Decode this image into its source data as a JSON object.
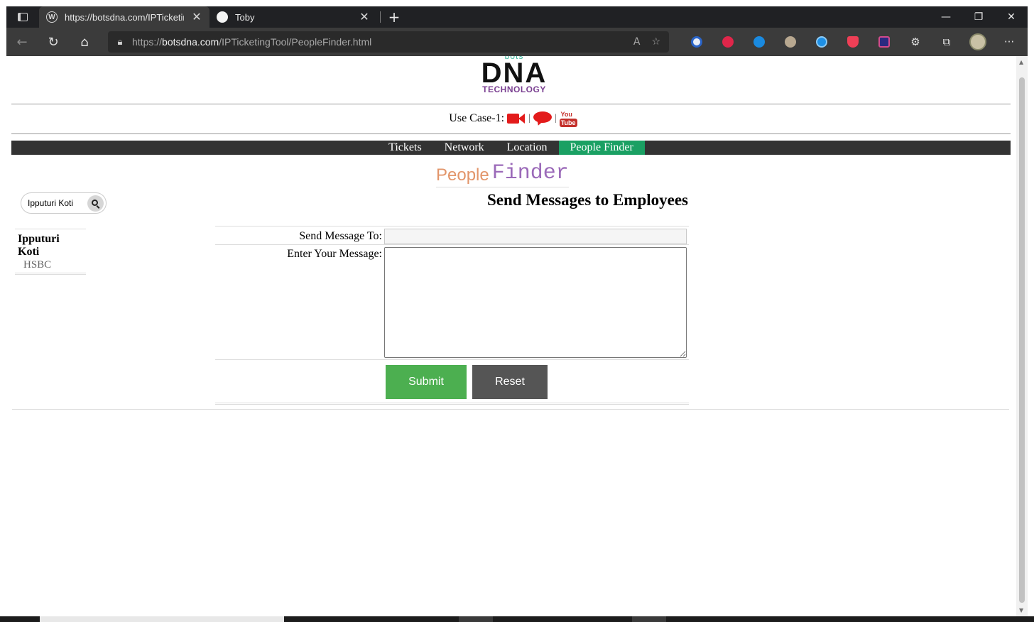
{
  "browser": {
    "tabs": [
      {
        "title": "https://botsdna.com/IPTicketing",
        "active": true,
        "favicon": "wordpress-icon"
      },
      {
        "title": "Toby",
        "active": false,
        "favicon": "toby-icon"
      }
    ],
    "address": {
      "scheme": "https://",
      "host": "botsdna.com",
      "path": "/IPTicketingTool/PeopleFinder.html"
    },
    "extensions": [
      "extension-blue-icon",
      "extension-red-icon",
      "extension-cloud-icon",
      "extension-owl-icon",
      "extension-circle-icon",
      "pocket-icon",
      "extension-grid-icon",
      "puzzle-icon",
      "collections-icon",
      "profile-avatar",
      "more-icon"
    ]
  },
  "logo": {
    "bots": "bots",
    "dna": "DNA",
    "tech": "TECHNOLOGY"
  },
  "usecase": {
    "label": "Use Case-1:",
    "icons": [
      "video-camera-icon",
      "chat-bubble-icon",
      "youtube-icon"
    ],
    "youtube_top": "You",
    "youtube_bottom": "Tube"
  },
  "nav": {
    "items": [
      "Tickets",
      "Network",
      "Location",
      "People Finder"
    ],
    "active": "People Finder"
  },
  "heading": {
    "people": "People",
    "finder": "Finder"
  },
  "search": {
    "value": "Ipputuri Koti"
  },
  "results": [
    {
      "name": "Ipputuri Koti",
      "company": "HSBC"
    }
  ],
  "form": {
    "title": "Send Messages to Employees",
    "to_label": "Send Message To:",
    "to_value": "",
    "message_label": "Enter Your Message:",
    "message_value": "",
    "submit_label": "Submit",
    "reset_label": "Reset"
  },
  "colors": {
    "nav_bg": "#333333",
    "nav_active": "#1aa063",
    "submit": "#4caf50",
    "reset": "#555555",
    "people": "#e2956a",
    "finder": "#9b6ab9",
    "usecase_icons": "#e31b1b"
  }
}
